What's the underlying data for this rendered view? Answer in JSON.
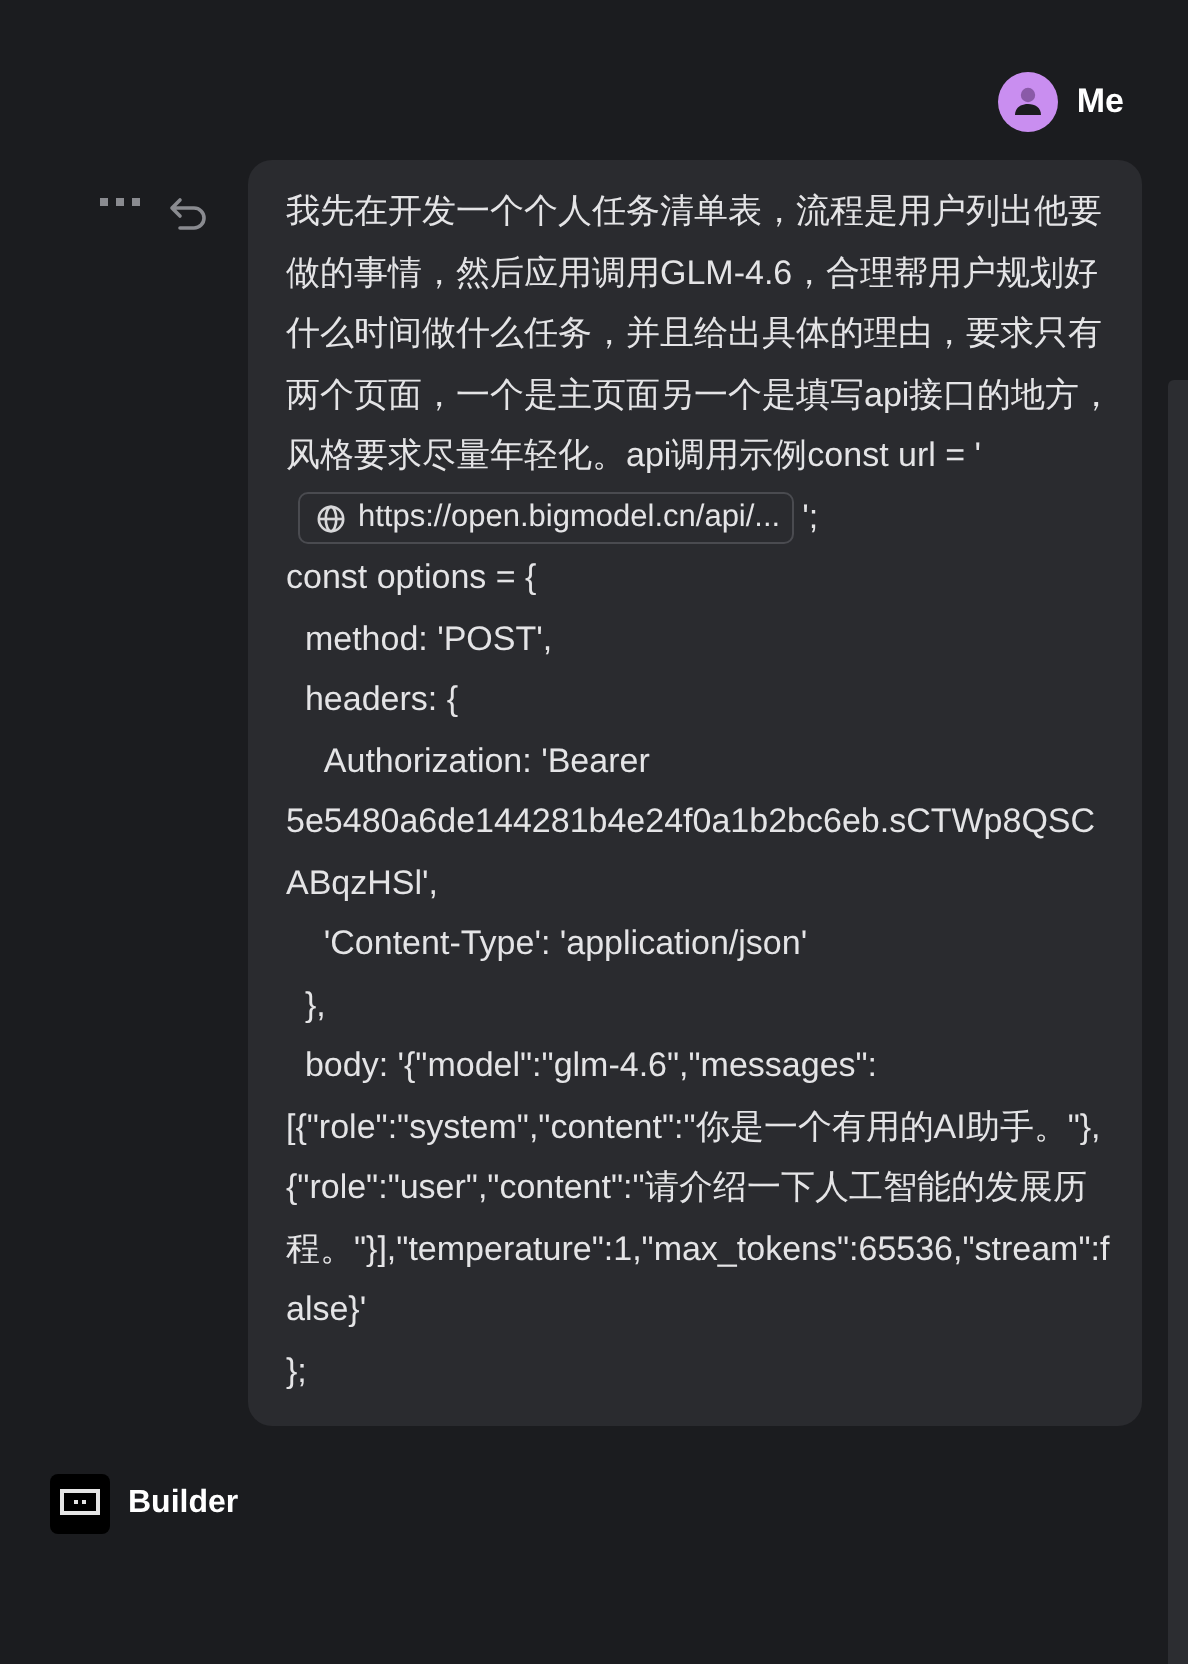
{
  "header": {
    "user": "Me"
  },
  "message": {
    "segments": [
      {
        "kind": "text",
        "text": "我先在开发一个个人任务清单表，流程是用户列出他要做的事情，然后应用调用GLM-4.6，合理帮用户规划好什么时间做什么任务，并且给出具体的理由，要求只有两个页面，一个是主页面另一个是填写api接口的地方，风格要求尽量年轻化。api调用示例const url = '"
      },
      {
        "kind": "link",
        "text": "https://open.bigmodel.cn/api/..."
      },
      {
        "kind": "text",
        "text": "';\nconst options = {\n  method: 'POST',\n  headers: {\n    Authorization: 'Bearer 5e5480a6de144281b4e24f0a1b2bc6eb.sCTWp8QSCABqzHSl',\n    'Content-Type': 'application/json'\n  },\n  body: '{\"model\":\"glm-4.6\",\"messages\":[{\"role\":\"system\",\"content\":\"你是一个有用的AI助手。\"},{\"role\":\"user\",\"content\":\"请介绍一下人工智能的发展历程。\"}],\"temperature\":1,\"max_tokens\":65536,\"stream\":false}'\n};"
      }
    ]
  },
  "footer": {
    "agent": "Builder"
  }
}
